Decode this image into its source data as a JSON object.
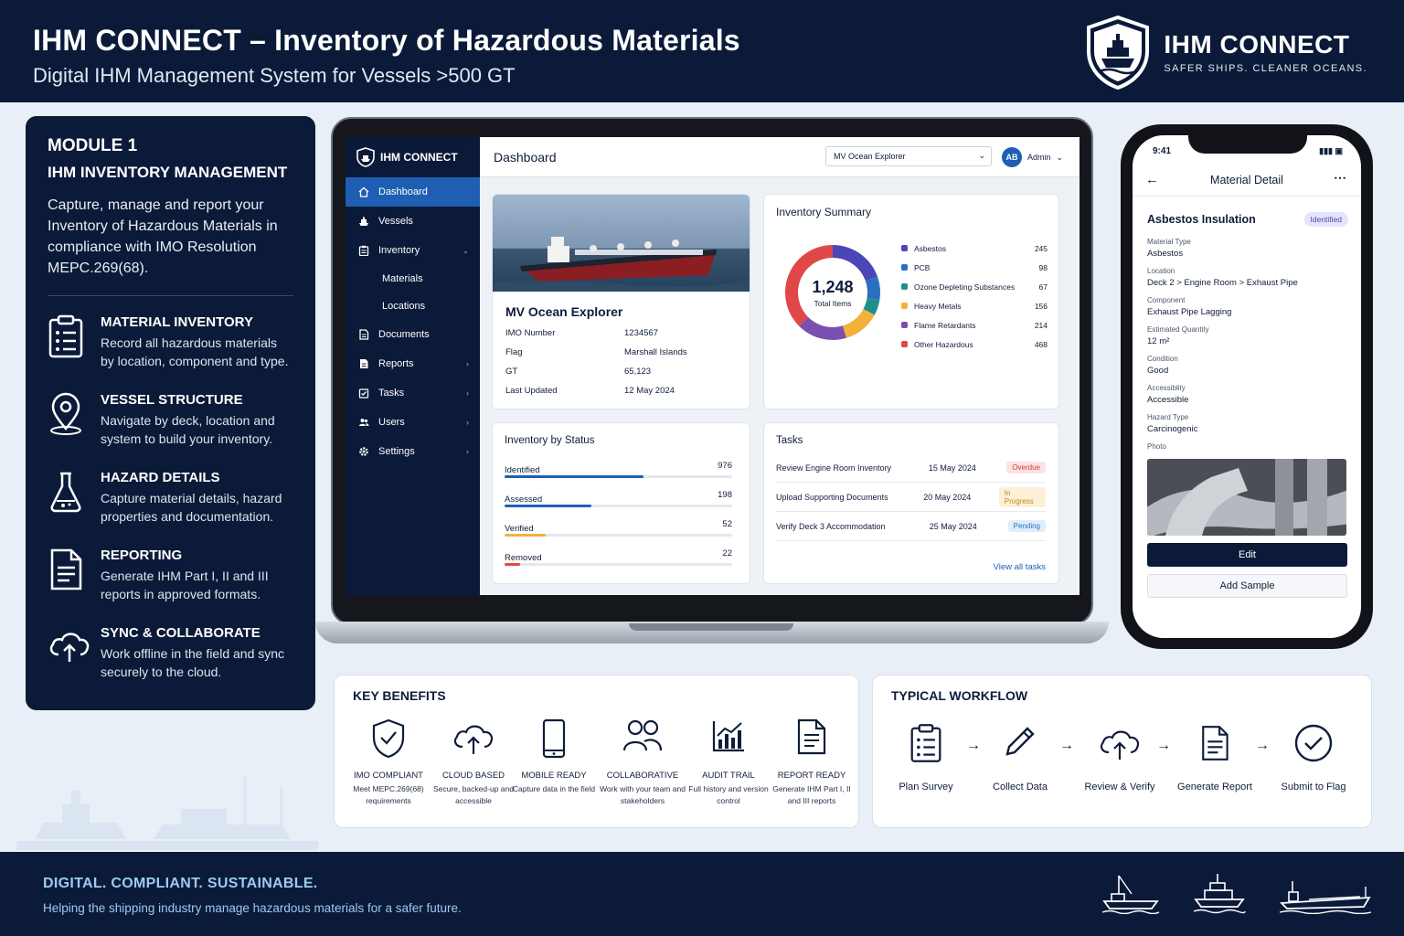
{
  "header": {
    "title": "IHM CONNECT – Inventory of Hazardous Materials",
    "subtitle": "Digital IHM Management System for Vessels >500 GT",
    "brand_name": "IHM CONNECT",
    "brand_tagline": "SAFER SHIPS. CLEANER OCEANS."
  },
  "module": {
    "kicker": "MODULE 1",
    "title": "IHM INVENTORY MANAGEMENT",
    "description": "Capture, manage and report your Inventory of Hazardous Materials in compliance with IMO Resolution MEPC.269(68).",
    "features": [
      {
        "icon": "clipboard-icon",
        "title": "MATERIAL INVENTORY",
        "desc": "Record all hazardous materials by location, component and type."
      },
      {
        "icon": "location-pin-icon",
        "title": "VESSEL STRUCTURE",
        "desc": "Navigate by deck, location and system to build your inventory."
      },
      {
        "icon": "flask-icon",
        "title": "HAZARD DETAILS",
        "desc": "Capture material details, hazard properties and documentation."
      },
      {
        "icon": "document-icon",
        "title": "REPORTING",
        "desc": "Generate IHM Part I, II and III reports in approved formats."
      },
      {
        "icon": "cloud-upload-icon",
        "title": "SYNC & COLLABORATE",
        "desc": "Work offline in the field and sync securely to the cloud."
      }
    ]
  },
  "app": {
    "logo": "IHM CONNECT",
    "sidebar": {
      "items": [
        {
          "label": "Dashboard",
          "icon": "home-icon"
        },
        {
          "label": "Vessels",
          "icon": "ship-icon"
        },
        {
          "label": "Inventory",
          "icon": "inventory-icon"
        },
        {
          "label": "Documents",
          "icon": "document-icon"
        },
        {
          "label": "Reports",
          "icon": "report-icon"
        },
        {
          "label": "Tasks",
          "icon": "tasks-icon"
        },
        {
          "label": "Users",
          "icon": "users-icon"
        },
        {
          "label": "Settings",
          "icon": "gear-icon"
        }
      ],
      "sub_items": [
        "Materials",
        "Locations"
      ]
    },
    "topbar": {
      "title": "Dashboard",
      "vessel_select": "MV Ocean Explorer",
      "avatar_initials": "AB",
      "user": "Admin"
    },
    "vessel": {
      "name": "MV Ocean Explorer",
      "rows": [
        {
          "k": "IMO Number",
          "v": "1234567"
        },
        {
          "k": "Flag",
          "v": "Marshall Islands"
        },
        {
          "k": "GT",
          "v": "65,123"
        },
        {
          "k": "Last Updated",
          "v": "12 May 2024"
        }
      ]
    },
    "inventory_summary": {
      "title": "Inventory Summary",
      "total": "1,248",
      "total_label": "Total Items"
    },
    "status": {
      "title": "Inventory by Status",
      "rows": [
        {
          "label": "Identified",
          "value": "976",
          "fraction": 0.61,
          "color": "#1e5fb3"
        },
        {
          "label": "Assessed",
          "value": "198",
          "fraction": 0.38,
          "color": "#1e5fb3"
        },
        {
          "label": "Verified",
          "value": "52",
          "fraction": 0.18,
          "color": "#f2b23a"
        },
        {
          "label": "Removed",
          "value": "22",
          "fraction": 0.07,
          "color": "#e04848"
        }
      ]
    },
    "tasks": {
      "title": "Tasks",
      "rows": [
        {
          "name": "Review Engine Room Inventory",
          "date": "15 May 2024",
          "badge": "Overdue",
          "bg": "#fde2e2",
          "fg": "#d23c3c"
        },
        {
          "name": "Upload Supporting Documents",
          "date": "20 May 2024",
          "badge": "In Progress",
          "bg": "#fdf0d8",
          "fg": "#c7861a"
        },
        {
          "name": "Verify Deck 3 Accommodation",
          "date": "25 May 2024",
          "badge": "Pending",
          "bg": "#dfeefb",
          "fg": "#2a6fc0"
        }
      ],
      "view_all": "View all tasks"
    }
  },
  "chart_data": {
    "type": "pie",
    "categories": [
      "Asbestos",
      "PCB",
      "Ozone Depleting Substances",
      "Heavy Metals",
      "Flame Retardants",
      "Other Hazardous"
    ],
    "values": [
      245,
      98,
      67,
      156,
      214,
      468
    ],
    "colors": [
      "#4b46b8",
      "#2a6fc0",
      "#1f8f8a",
      "#f2b23a",
      "#7b4fb0",
      "#e04848"
    ],
    "donut": true,
    "center_value": "1,248",
    "center_label": "Total Items",
    "title": "Inventory Summary",
    "legend": "right"
  },
  "phone": {
    "time": "9:41",
    "title": "Material Detail",
    "material": "Asbestos Insulation",
    "badge": "Identified",
    "fields": [
      {
        "k": "Material Type",
        "v": "Asbestos"
      },
      {
        "k": "Location",
        "v": "Deck 2  >  Engine Room  >  Exhaust Pipe"
      },
      {
        "k": "Component",
        "v": "Exhaust Pipe Lagging"
      },
      {
        "k": "Estimated Quantity",
        "v": "12 m²"
      },
      {
        "k": "Condition",
        "v": "Good"
      },
      {
        "k": "Accessiblity",
        "v": "Accessible"
      },
      {
        "k": "Hazard Type",
        "v": "Carcinogenic"
      }
    ],
    "photo_label": "Photo",
    "edit": "Edit",
    "add_sample": "Add Sample"
  },
  "benefits": {
    "title": "KEY BENEFITS",
    "items": [
      {
        "icon": "shield-check-icon",
        "title": "IMO COMPLIANT",
        "desc": "Meet MEPC.269(68) requirements"
      },
      {
        "icon": "cloud-upload-icon",
        "title": "CLOUD BASED",
        "desc": "Secure, backed-up and accessible"
      },
      {
        "icon": "mobile-icon",
        "title": "MOBILE READY",
        "desc": "Capture data in the field"
      },
      {
        "icon": "team-icon",
        "title": "COLLABORATIVE",
        "desc": "Work with your team and stakeholders"
      },
      {
        "icon": "chart-icon",
        "title": "AUDIT TRAIL",
        "desc": "Full history and version control"
      },
      {
        "icon": "report-icon",
        "title": "REPORT READY",
        "desc": "Generate IHM Part I, II and III reports"
      }
    ]
  },
  "workflow": {
    "title": "TYPICAL WORKFLOW",
    "steps": [
      {
        "icon": "clipboard-icon",
        "label": "Plan Survey"
      },
      {
        "icon": "pencil-icon",
        "label": "Collect Data"
      },
      {
        "icon": "cloud-upload-icon",
        "label": "Review & Verify"
      },
      {
        "icon": "document-icon",
        "label": "Generate Report"
      },
      {
        "icon": "check-circle-icon",
        "label": "Submit to Flag"
      }
    ]
  },
  "footer": {
    "headline": "DIGITAL. COMPLIANT. SUSTAINABLE.",
    "tagline": "Helping the shipping industry manage hazardous materials for a safer future."
  }
}
